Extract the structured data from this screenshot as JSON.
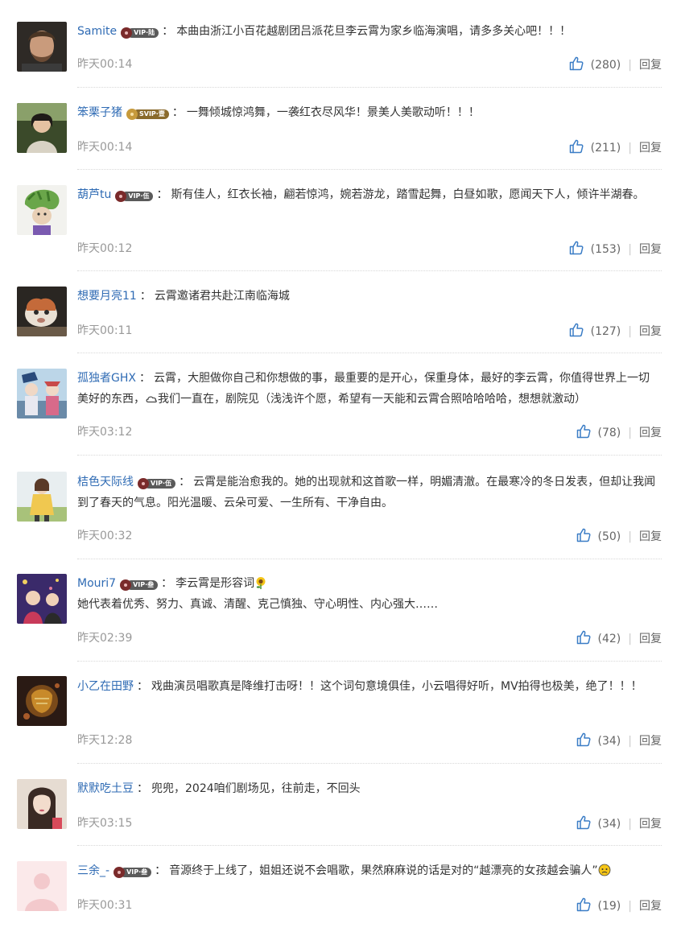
{
  "icons": {
    "like": "thumbs-up-icon",
    "cloud": "cloud-icon",
    "sunflower": "sunflower-emoji",
    "pouting": "pouting-face-emoji"
  },
  "colors": {
    "username": "#2f6bb4",
    "like_icon": "#3b7dc6",
    "time": "#999999"
  },
  "comments": [
    {
      "username": "Samite",
      "vip_badge": "VIP·陆",
      "text": "本曲由浙江小百花越剧团吕派花旦李云霄为家乡临海演唱，请多多关心吧！！！",
      "time": "昨天00:14",
      "likes": "(280)",
      "reply": "回复"
    },
    {
      "username": "笨栗子猪",
      "vip_badge": "SVIP·壹",
      "text": "一舞倾城惊鸿舞，一袭红衣尽风华！景美人美歌动听！！！",
      "time": "昨天00:14",
      "likes": "(211)",
      "reply": "回复"
    },
    {
      "username": "葫芦tu",
      "vip_badge": "VIP·伍",
      "text": "斯有佳人，红衣长袖，翩若惊鸿，婉若游龙，踏雪起舞，白昼如歌，愿闻天下人，倾许半湖春。",
      "time": "昨天00:12",
      "likes": "(153)",
      "reply": "回复"
    },
    {
      "username": "想要月亮11",
      "text": "云霄邀诸君共赴江南临海城",
      "time": "昨天00:11",
      "likes": "(127)",
      "reply": "回复"
    },
    {
      "username": "孤独者GHX",
      "text_a": "云霄，大胆做你自己和你想做的事，最重要的是开心，保重身体，最好的李云霄，你值得世界上一切美好的东西，",
      "text_b": "我们一直在，剧院见（浅浅许个愿，希望有一天能和云霄合照哈哈哈哈，想想就激动）",
      "time": "昨天03:12",
      "likes": "(78)",
      "reply": "回复"
    },
    {
      "username": "桔色天际线",
      "vip_badge": "VIP·伍",
      "text": "云霄是能治愈我的。她的出现就和这首歌一样，明媚清澈。在最寒冷的冬日发表，但却让我闻到了春天的气息。阳光温暖、云朵可爱、一生所有、干净自由。",
      "time": "昨天00:32",
      "likes": "(50)",
      "reply": "回复"
    },
    {
      "username": "Mouri7",
      "vip_badge": "VIP·叁",
      "text": "李云霄是形容词",
      "text_line2": "她代表着优秀、努力、真诚、清醒、克己慎独、守心明性、内心强大……",
      "time": "昨天02:39",
      "likes": "(42)",
      "reply": "回复"
    },
    {
      "username": "小乙在田野",
      "text": "戏曲演员唱歌真是降维打击呀！！这个词句意境俱佳，小云唱得好听，MV拍得也极美，绝了！！！",
      "time": "昨天12:28",
      "likes": "(34)",
      "reply": "回复"
    },
    {
      "username": "默默吃土豆",
      "text": "兜兜，2024咱们剧场见，往前走，不回头",
      "time": "昨天03:15",
      "likes": "(34)",
      "reply": "回复"
    },
    {
      "username": "三余_-",
      "vip_badge": "VIP·叁",
      "text": "音源终于上线了，姐姐还说不会唱歌，果然麻麻说的话是对的“越漂亮的女孩越会骗人”",
      "time": "昨天00:31",
      "likes": "(19)",
      "reply": "回复"
    }
  ]
}
